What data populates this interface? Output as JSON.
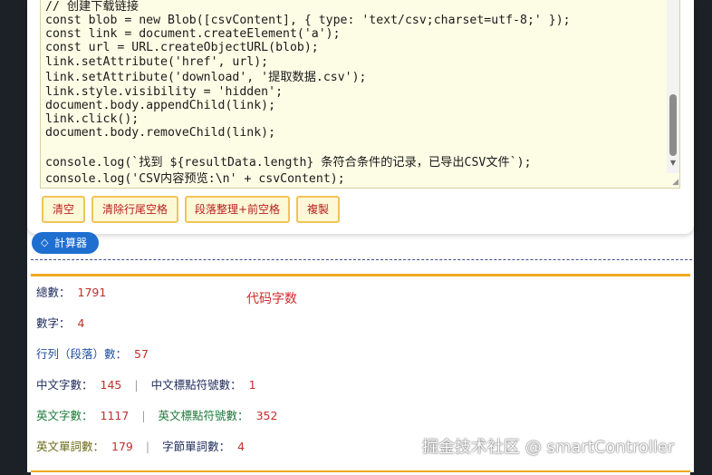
{
  "code": {
    "lines": [
      "// 创建下载链接",
      "const blob = new Blob([csvContent], { type: 'text/csv;charset=utf-8;' });",
      "const link = document.createElement('a');",
      "const url = URL.createObjectURL(blob);",
      "link.setAttribute('href', url);",
      "link.setAttribute('download', '提取数据.csv');",
      "link.style.visibility = 'hidden';",
      "document.body.appendChild(link);",
      "link.click();",
      "document.body.removeChild(link);",
      "",
      "console.log(`找到 ${resultData.length} 条符合条件的记录，已导出CSV文件`);",
      "console.log('CSV内容预览:\\n' + csvContent);"
    ]
  },
  "toolbar": {
    "clear_label": "清空",
    "trim_label": "清除行尾空格",
    "paragraph_label": "段落整理+前空格",
    "copy_label": "複製"
  },
  "tag": {
    "icon": "tag-icon",
    "label": "計算器"
  },
  "stats": {
    "title": "代码字数",
    "total": {
      "label": "總數：",
      "value": "1791"
    },
    "digits": {
      "label": "數字：",
      "value": "4"
    },
    "lines": {
      "label": "行列（段落）數：",
      "value": "57"
    },
    "chinese_chars": {
      "label": "中文字數：",
      "value": "145"
    },
    "chinese_punct": {
      "label": "中文標點符號數：",
      "value": "1"
    },
    "english_chars": {
      "label": "英文字數：",
      "value": "1117"
    },
    "english_punct": {
      "label": "英文標點符號數：",
      "value": "352"
    },
    "english_words": {
      "label": "英文單詞數：",
      "value": "179"
    },
    "byte_words": {
      "label": "字節單詞數：",
      "value": "4"
    },
    "separator": "|"
  },
  "watermark": "掘金技术社区 @ smartController",
  "colors": {
    "accent_orange": "#f0a81e",
    "tag_blue": "#1f6fd1",
    "value_red": "#c0302b",
    "label_navy": "#1e2a5a",
    "label_blue": "#1f4fa0",
    "label_green": "#1b7a3a",
    "label_olive": "#6b6a1a"
  }
}
